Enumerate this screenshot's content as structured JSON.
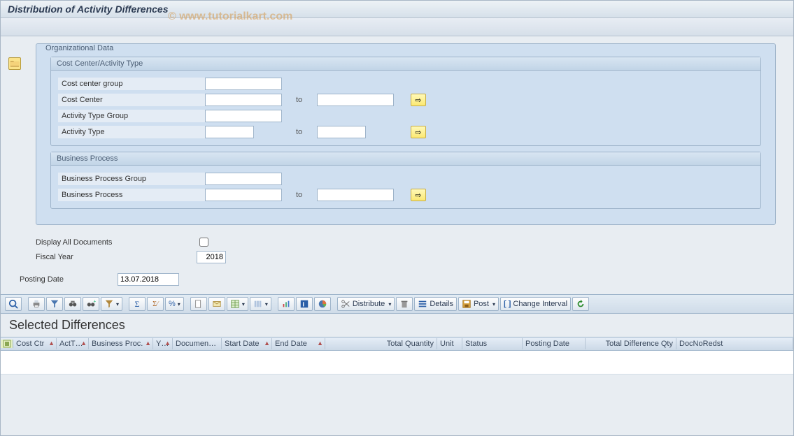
{
  "title": "Distribution of Activity Differences",
  "watermark": "© www.tutorialkart.com",
  "org_group": {
    "legend": "Organizational Data",
    "cc_section": {
      "header": "Cost Center/Activity Type",
      "cost_center_group_label": "Cost center group",
      "cost_center_group_value": "",
      "cost_center_label": "Cost Center",
      "cost_center_from": "",
      "cost_center_to_label": "to",
      "cost_center_to": "",
      "act_type_group_label": "Activity Type Group",
      "act_type_group_value": "",
      "act_type_label": "Activity Type",
      "act_type_from": "",
      "act_type_to_label": "to",
      "act_type_to": ""
    },
    "bp_section": {
      "header": "Business Process",
      "bp_group_label": "Business Process Group",
      "bp_group_value": "",
      "bp_label": "Business Process",
      "bp_from": "",
      "bp_to_label": "to",
      "bp_to": ""
    }
  },
  "options": {
    "display_all_label": "Display All Documents",
    "display_all_checked": false,
    "fiscal_year_label": "Fiscal Year",
    "fiscal_year_value": "2018",
    "posting_date_label": "Posting Date",
    "posting_date_value": "13.07.2018"
  },
  "alv": {
    "distribute_label": "Distribute",
    "details_label": "Details",
    "post_label": "Post",
    "change_interval_label": "Change Interval",
    "heading": "Selected Differences",
    "columns": {
      "c1": "Cost Ctr",
      "c2": "ActT…",
      "c3": "Business Proc.",
      "c4": "Y…",
      "c5": "Documen…",
      "c6": "Start Date",
      "c7": "End Date",
      "c8": "Total Quantity",
      "c9": "Unit",
      "c10": "Status",
      "c11": "Posting Date",
      "c12": "Total Difference Qty",
      "c13": "DocNoRedst"
    }
  }
}
